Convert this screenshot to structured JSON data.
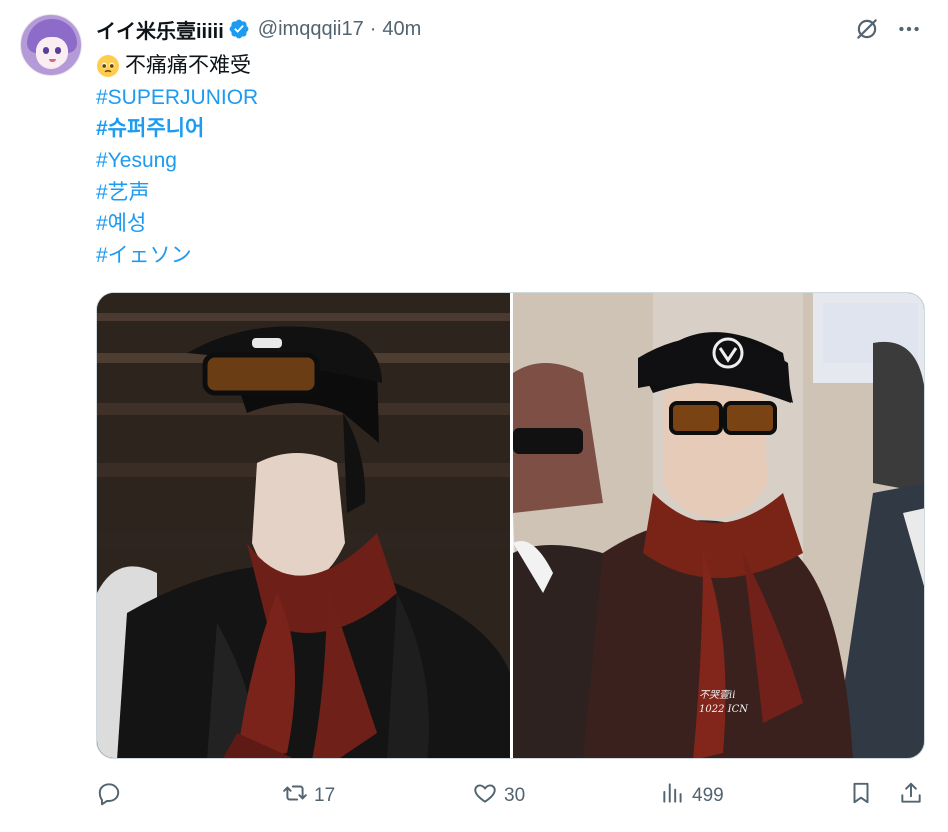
{
  "tweet": {
    "display_name": "イイ米乐壹iiiii",
    "handle": "@imqqqii17",
    "separator": "·",
    "time": "40m",
    "lines": [
      {
        "text": "不痛痛不难受",
        "type": "text",
        "emoji": "pleading-face"
      },
      {
        "text": "#SUPERJUNIOR",
        "type": "hashtag"
      },
      {
        "text": "#슈퍼주니어",
        "type": "hashtag-bold"
      },
      {
        "text": "#Yesung",
        "type": "hashtag"
      },
      {
        "text": "#艺声",
        "type": "hashtag"
      },
      {
        "text": "#예성",
        "type": "hashtag"
      },
      {
        "text": "#イェソン",
        "type": "hashtag"
      }
    ],
    "media": {
      "count": 2,
      "watermark_right": "不哭壹ii\n1022 ICN"
    },
    "actions": {
      "reply": {
        "label": "",
        "icon": "reply-icon"
      },
      "retweet": {
        "count": "17",
        "icon": "retweet-icon"
      },
      "like": {
        "count": "30",
        "icon": "heart-icon"
      },
      "views": {
        "count": "499",
        "icon": "bar-chart-icon"
      },
      "bookmark": {
        "icon": "bookmark-icon"
      },
      "share": {
        "icon": "share-icon"
      }
    }
  },
  "colors": {
    "link": "#1d9bf0",
    "secondary": "#536471",
    "primary": "#0f1419",
    "verified": "#1d9bf0"
  }
}
